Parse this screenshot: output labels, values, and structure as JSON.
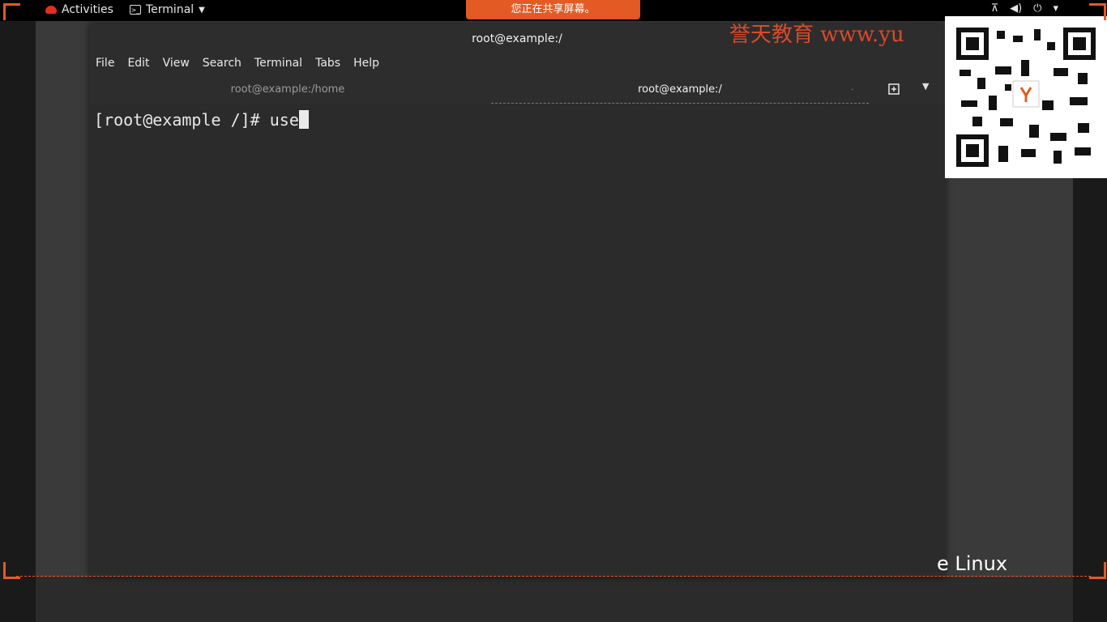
{
  "topbar": {
    "activities": "Activities",
    "app_menu": "Terminal",
    "tray_icons": [
      "network-icon",
      "volume-icon",
      "power-icon",
      "chevron-down-icon"
    ]
  },
  "share_banner": "您正在共享屏幕。",
  "terminal": {
    "title": "root@example:/",
    "menus": [
      "File",
      "Edit",
      "View",
      "Search",
      "Terminal",
      "Tabs",
      "Help"
    ],
    "tabs": [
      {
        "label": "root@example:/home",
        "active": false
      },
      {
        "label": "root@example:/",
        "active": true
      }
    ],
    "prompt": "[root@example /]# ",
    "typed": "use"
  },
  "watermark": "誉天教育 www.yu",
  "desktop_text": "e Linux",
  "colors": {
    "accent": "#e35a24",
    "terminal_bg": "#2b2b2b"
  }
}
